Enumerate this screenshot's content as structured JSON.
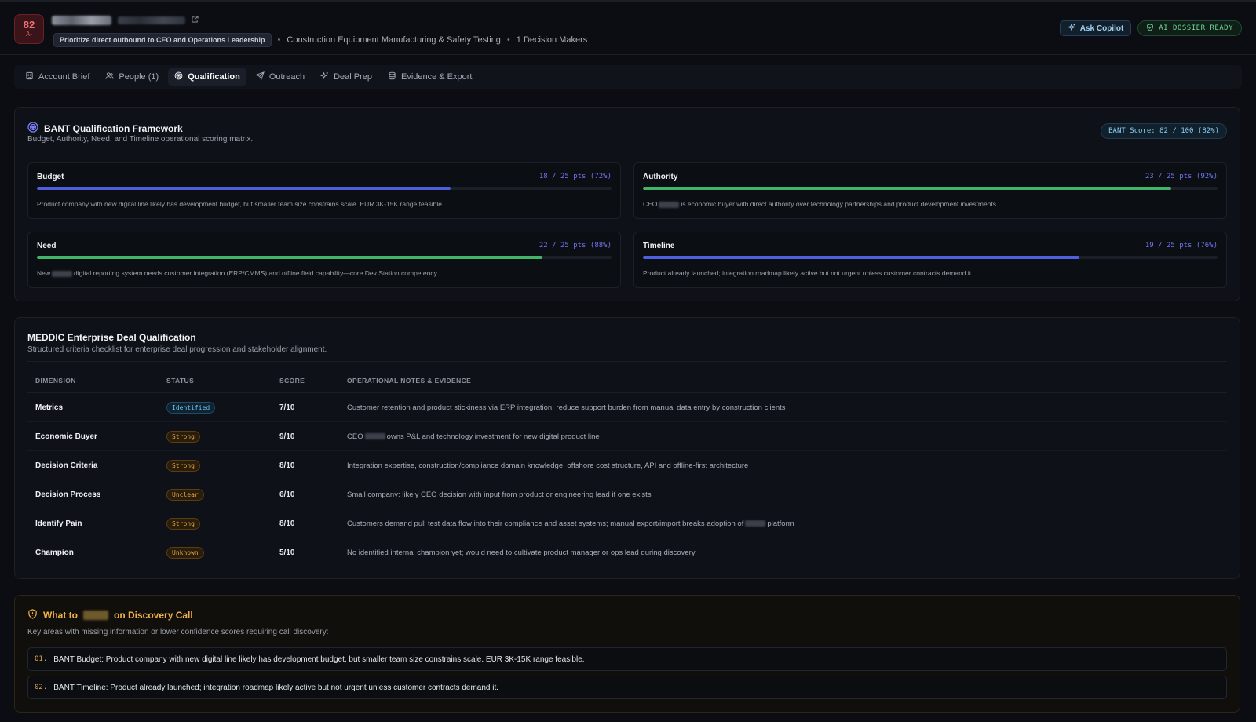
{
  "header": {
    "score": "82",
    "grade": "A-",
    "priority": "Prioritize direct outbound to CEO and Operations Leadership",
    "industry": "Construction Equipment Manufacturing & Safety Testing",
    "decision_makers": "1 Decision Makers",
    "ask_copilot": "Ask Copilot",
    "dossier_status": "AI DOSSIER READY"
  },
  "tabs": [
    {
      "label": "Account Brief",
      "icon": "building-icon"
    },
    {
      "label": "People (1)",
      "icon": "people-icon"
    },
    {
      "label": "Qualification",
      "icon": "target-icon",
      "active": true
    },
    {
      "label": "Outreach",
      "icon": "send-icon"
    },
    {
      "label": "Deal Prep",
      "icon": "sparkle-icon"
    },
    {
      "label": "Evidence & Export",
      "icon": "database-icon"
    }
  ],
  "bant": {
    "title": "BANT Qualification Framework",
    "subtitle": "Budget, Authority, Need, and Timeline operational scoring matrix.",
    "score_badge": "BANT Score: 82 / 100 (82%)",
    "criteria": [
      {
        "name": "Budget",
        "pts": "18 / 25 pts (72%)",
        "fraction": 0.72,
        "color": "blue",
        "note": "Product company with new digital line likely has development budget, but smaller team size constrains scale. EUR 3K-15K range feasible."
      },
      {
        "name": "Authority",
        "pts": "23 / 25 pts (92%)",
        "fraction": 0.92,
        "color": "green",
        "note_pre": "CEO",
        "note_post": "is economic buyer with direct authority over technology partnerships and product development investments."
      },
      {
        "name": "Need",
        "pts": "22 / 25 pts (88%)",
        "fraction": 0.88,
        "color": "green",
        "note_pre": "New",
        "note_post": "digital reporting system needs customer integration (ERP/CMMS) and offline field capability—core Dev Station competency."
      },
      {
        "name": "Timeline",
        "pts": "19 / 25 pts (76%)",
        "fraction": 0.76,
        "color": "blue",
        "note": "Product already launched; integration roadmap likely active but not urgent unless customer contracts demand it."
      }
    ]
  },
  "meddic": {
    "title": "MEDDIC Enterprise Deal Qualification",
    "subtitle": "Structured criteria checklist for enterprise deal progression and stakeholder alignment.",
    "columns": [
      "DIMENSION",
      "STATUS",
      "SCORE",
      "OPERATIONAL NOTES & EVIDENCE"
    ],
    "rows": [
      {
        "dimension": "Metrics",
        "status": "Identified",
        "status_kind": "identified",
        "score": "7/10",
        "notes": "Customer retention and product stickiness via ERP integration; reduce support burden from manual data entry by construction clients"
      },
      {
        "dimension": "Economic Buyer",
        "status": "Strong",
        "status_kind": "strong",
        "score": "9/10",
        "notes_pre": "CEO",
        "notes_post": "owns P&L and technology investment for new digital product line"
      },
      {
        "dimension": "Decision Criteria",
        "status": "Strong",
        "status_kind": "strong",
        "score": "8/10",
        "notes": "Integration expertise, construction/compliance domain knowledge, offshore cost structure, API and offline-first architecture"
      },
      {
        "dimension": "Decision Process",
        "status": "Unclear",
        "status_kind": "unclear",
        "score": "6/10",
        "notes": "Small company: likely CEO decision with input from product or engineering lead if one exists"
      },
      {
        "dimension": "Identify Pain",
        "status": "Strong",
        "status_kind": "strong",
        "score": "8/10",
        "notes_pre": "Customers demand pull test data flow into their compliance and asset systems; manual export/import breaks adoption of",
        "notes_post": "platform"
      },
      {
        "dimension": "Champion",
        "status": "Unknown",
        "status_kind": "unknown",
        "score": "5/10",
        "notes": "No identified internal champion yet; would need to cultivate product manager or ops lead during discovery"
      }
    ]
  },
  "discovery": {
    "title_pre": "What to",
    "title_post": "on Discovery Call",
    "subtitle": "Key areas with missing information or lower confidence scores requiring call discovery:",
    "items": [
      {
        "index": "01.",
        "text": "BANT Budget: Product company with new digital line likely has development budget, but smaller team size constrains scale. EUR 3K-15K range feasible."
      },
      {
        "index": "02.",
        "text": "BANT Timeline: Product already launched; integration roadmap likely active but not urgent unless customer contracts demand it."
      }
    ]
  },
  "colors": {
    "accent_blue": "#4f5fe0",
    "accent_green": "#43b36a",
    "warning_amber": "#f0b14a",
    "score_red": "#f2737a"
  }
}
